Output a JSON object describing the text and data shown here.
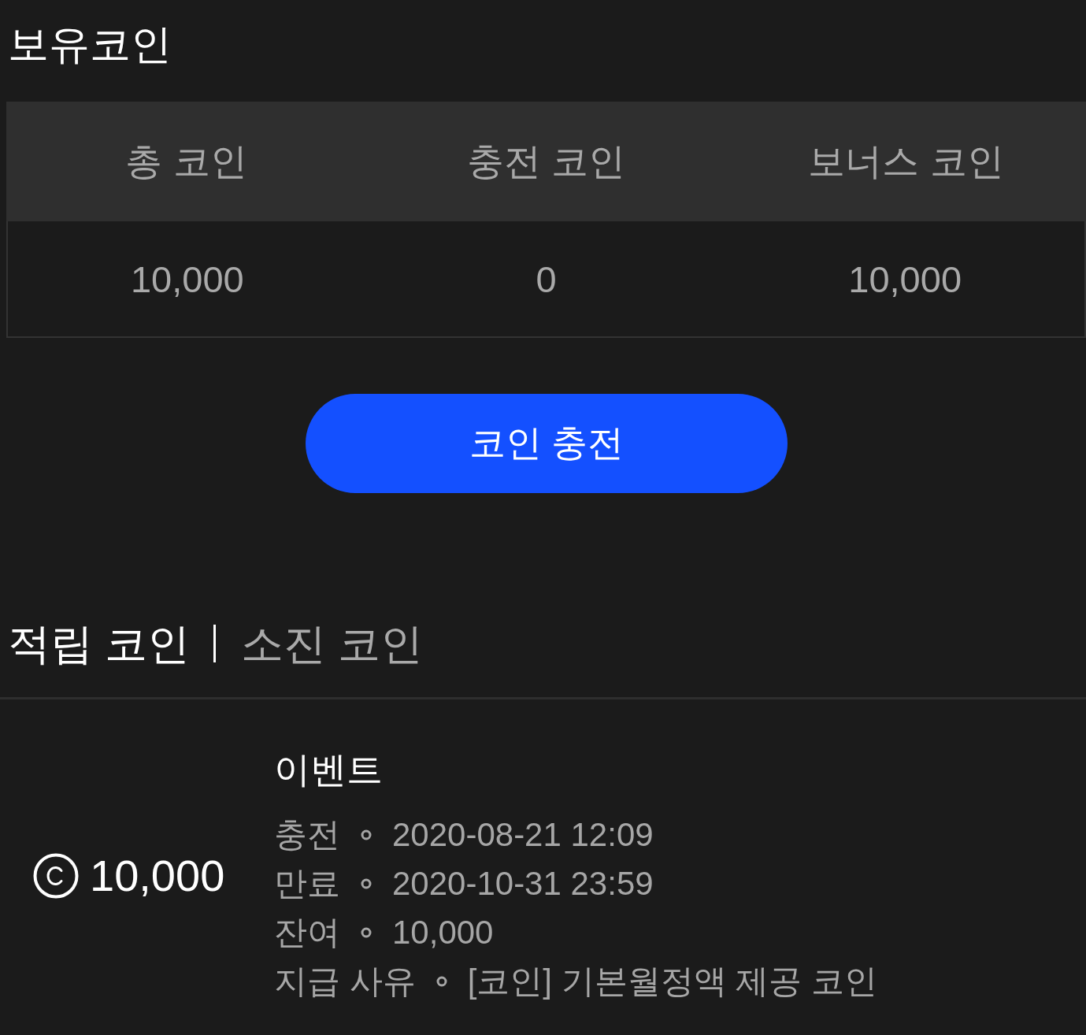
{
  "title": "보유코인",
  "summary": {
    "columns": [
      "총 코인",
      "충전 코인",
      "보너스 코인"
    ],
    "values": [
      "10,000",
      "0",
      "10,000"
    ]
  },
  "charge_button": {
    "label": "코인 충전"
  },
  "tabs": [
    {
      "label": "적립 코인",
      "selected": true
    },
    {
      "label": "소진 코인",
      "selected": false
    }
  ],
  "entries": [
    {
      "amount": "10,000",
      "title": "이벤트",
      "details": [
        {
          "label": "충전",
          "value": "2020-08-21 12:09"
        },
        {
          "label": "만료",
          "value": "2020-10-31 23:59"
        },
        {
          "label": "잔여",
          "value": "10,000"
        },
        {
          "label": "지급 사유",
          "value": "[코인] 기본월정액 제공 코인"
        }
      ]
    }
  ]
}
